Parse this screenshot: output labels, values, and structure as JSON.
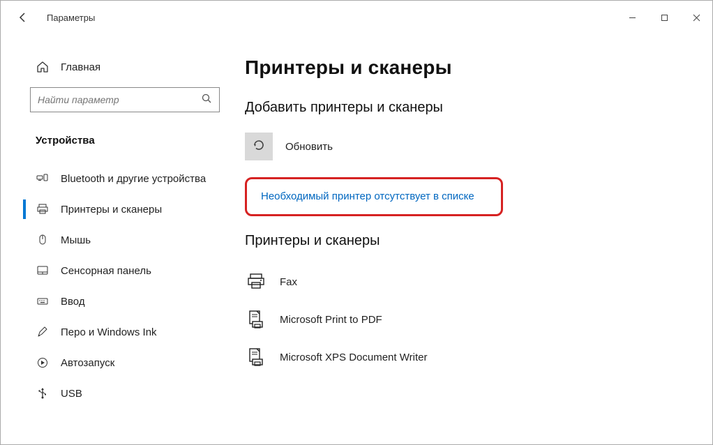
{
  "window": {
    "title": "Параметры"
  },
  "sidebar": {
    "home_label": "Главная",
    "search_placeholder": "Найти параметр",
    "category_label": "Устройства",
    "items": [
      {
        "label": "Bluetooth и другие устройства"
      },
      {
        "label": "Принтеры и сканеры"
      },
      {
        "label": "Мышь"
      },
      {
        "label": "Сенсорная панель"
      },
      {
        "label": "Ввод"
      },
      {
        "label": "Перо и Windows Ink"
      },
      {
        "label": "Автозапуск"
      },
      {
        "label": "USB"
      }
    ]
  },
  "main": {
    "page_title": "Принтеры и сканеры",
    "add_section_title": "Добавить принтеры и сканеры",
    "refresh_label": "Обновить",
    "missing_printer_link": "Необходимый принтер отсутствует в списке",
    "list_section_title": "Принтеры и сканеры",
    "printers": [
      {
        "label": "Fax"
      },
      {
        "label": "Microsoft Print to PDF"
      },
      {
        "label": "Microsoft XPS Document Writer"
      }
    ]
  }
}
